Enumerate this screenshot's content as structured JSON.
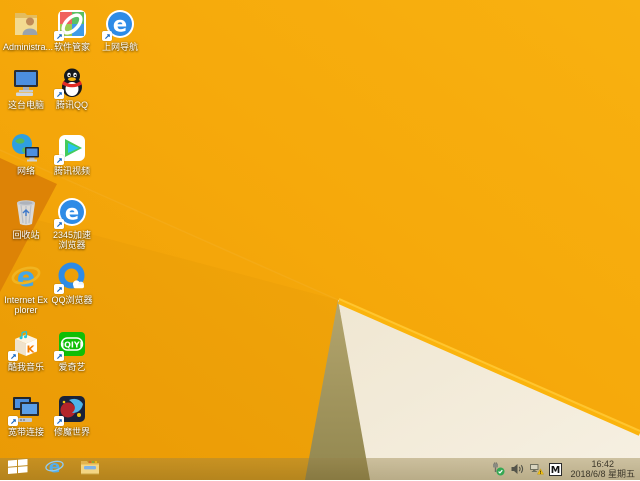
{
  "wallpaper": {
    "base_color": "#F6A90B",
    "base_light_color": "#F8B110",
    "base_dark_color": "#EE9E06",
    "left_fold_color": "#DD8306",
    "olive_triangle_color": "#A89A62",
    "cream_triangle_color": "#F3ECDC",
    "highlight_edge_color": "#FBB40D"
  },
  "desktop_icons": [
    {
      "id": "administrator-folder",
      "icon": "user-folder-icon",
      "label": "Administra...",
      "shortcut": false
    },
    {
      "id": "software-manager",
      "icon": "software-manager-icon",
      "label": "软件管家",
      "shortcut": true
    },
    {
      "id": "internet-navigation",
      "icon": "blue-e-browser-icon",
      "label": "上网导航",
      "shortcut": true
    },
    {
      "id": "this-pc",
      "icon": "computer-icon",
      "label": "这台电脑",
      "shortcut": false
    },
    {
      "id": "tencent-qq",
      "icon": "qq-penguin-icon",
      "label": "腾讯QQ",
      "shortcut": true
    },
    {
      "id": "network",
      "icon": "network-globe-icon",
      "label": "网络",
      "shortcut": false
    },
    {
      "id": "tencent-video",
      "icon": "play-triangle-icon",
      "label": "腾讯视频",
      "shortcut": true
    },
    {
      "id": "recycle-bin",
      "icon": "recycle-bin-icon",
      "label": "回收站",
      "shortcut": false
    },
    {
      "id": "2345-browser",
      "icon": "blue-e-browser-icon",
      "label": "2345加速浏览器",
      "shortcut": true
    },
    {
      "id": "internet-explorer",
      "icon": "ie-icon",
      "label": "Internet Explorer",
      "shortcut": false
    },
    {
      "id": "qq-browser",
      "icon": "qq-browser-icon",
      "label": "QQ浏览器",
      "shortcut": true
    },
    {
      "id": "kuwo-music",
      "icon": "music-box-icon",
      "label": "酷我音乐",
      "shortcut": true
    },
    {
      "id": "iqiyi",
      "icon": "iqiyi-icon",
      "label": "爱奇艺",
      "shortcut": true
    },
    {
      "id": "broadband-connection",
      "icon": "dual-monitor-icon",
      "label": "宽带连接",
      "shortcut": true
    },
    {
      "id": "xiumo-world-game",
      "icon": "game-icon",
      "label": "修魔世界",
      "shortcut": true
    }
  ],
  "taskbar": {
    "buttons": [
      {
        "id": "start",
        "icon": "windows-logo-icon"
      },
      {
        "id": "internet-explorer",
        "icon": "ie-icon"
      },
      {
        "id": "file-explorer",
        "icon": "folder-icon"
      }
    ],
    "tray": {
      "icons": [
        {
          "icon": "safely-remove-hardware-icon"
        },
        {
          "icon": "volume-icon"
        },
        {
          "icon": "network-warning-icon"
        },
        {
          "icon": "input-method-icon",
          "label": "M"
        }
      ],
      "clock": {
        "time": "16:42",
        "date": "2018/6/8 星期五"
      }
    }
  }
}
